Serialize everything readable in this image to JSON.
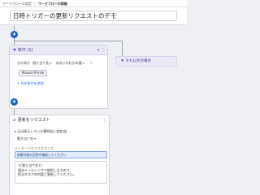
{
  "breadcrumb": {
    "parent": "ワークフローの設定",
    "separator": "|",
    "current": "ワークフローの詳細"
  },
  "page_title": "日時トリガーの更新リクエストのデモ",
  "flow": {
    "add_icon": "+",
    "condition": {
      "title": "条件 (1)",
      "filter_icon": "filter-icon",
      "head_icons": "▾ ⋮",
      "row_label": "次の場合",
      "field_select": "割り当て先",
      "operator_select": "次のいずれかの値",
      "value_chip": "Mussel Prinile",
      "add_condition": "+ 別の条件を追加"
    },
    "otherwise": {
      "title": "それ以外の場合"
    },
    "action": {
      "title": "更新をリクエスト",
      "toggle_label": "元は表示している事例化に追加",
      "sub_select": "割り当て先",
      "message_label": "メッセージをカスタマイズ",
      "message_field": "依頼内容の回答を確認してください",
      "message_body_1": "{{割り当て先}}",
      "message_body_2": "週次ミーティングで使用しますので、",
      "message_body_3": "担当タスクの内容ご更新してください。"
    }
  }
}
